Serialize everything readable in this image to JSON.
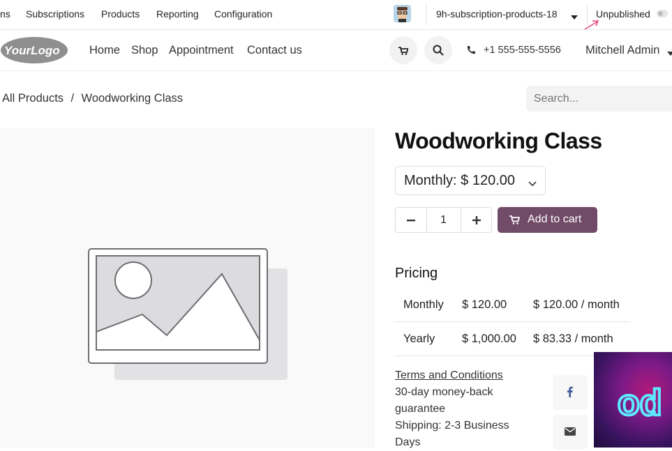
{
  "topbar": {
    "menu": [
      "ns",
      "Subscriptions",
      "Products",
      "Reporting",
      "Configuration"
    ],
    "database": "9h-subscription-products-18",
    "publish_status": "Unpublished"
  },
  "header": {
    "logo": "YourLogo",
    "nav": [
      "Home",
      "Shop",
      "Appointment",
      "Contact us"
    ],
    "phone": "+1 555-555-5556",
    "user": "Mitchell Admin"
  },
  "breadcrumb": {
    "parent": "All Products",
    "separator": "/",
    "current": "Woodworking Class"
  },
  "search": {
    "placeholder": "Search..."
  },
  "product": {
    "title": "Woodworking Class",
    "plan_selected": "Monthly: $ 120.00",
    "quantity": "1",
    "add_to_cart": "Add to cart"
  },
  "pricing": {
    "heading": "Pricing",
    "rows": [
      {
        "period": "Monthly",
        "price": "$ 120.00",
        "per_month": "$ 120.00 / month"
      },
      {
        "period": "Yearly",
        "price": "$ 1,000.00",
        "per_month": "$ 83.33 / month"
      }
    ]
  },
  "terms": {
    "link": "Terms and Conditions",
    "guarantee": "30-day money-back guarantee",
    "shipping": "Shipping: 2-3 Business Days"
  },
  "video_overlay": {
    "text": "od"
  },
  "colors": {
    "primary": "#714b67",
    "accent_arrow": "#e8467c"
  }
}
